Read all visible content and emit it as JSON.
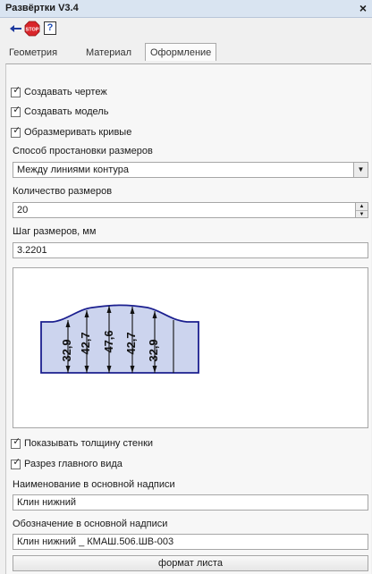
{
  "window": {
    "title": "Развёртки V3.4",
    "close_glyph": "×"
  },
  "toolbar": {
    "icons": [
      "back-arrow-icon",
      "stop-icon",
      "help-icon"
    ],
    "stop_text": "STOP",
    "help_glyph": "?"
  },
  "tabs": [
    {
      "label": "Геометрия",
      "active": false
    },
    {
      "label": "Материал",
      "active": false
    },
    {
      "label": "Оформление",
      "active": true
    }
  ],
  "options": {
    "create_drawing": {
      "label": "Создавать чертеж",
      "checked": true
    },
    "create_model": {
      "label": "Создавать модель",
      "checked": true
    },
    "dimension_curves": {
      "label": "Образмеривать кривые",
      "checked": true
    }
  },
  "dimension_method": {
    "label": "Способ простановки размеров",
    "value": "Между линиями контура"
  },
  "dimension_count": {
    "label": "Количество размеров",
    "value": "20"
  },
  "dimension_step": {
    "label": "Шаг размеров, мм",
    "value": "3.2201"
  },
  "preview": {
    "dimensions": [
      "32,9",
      "42,7",
      "47,6",
      "42,7",
      "32,9"
    ]
  },
  "show_wall_thickness": {
    "label": "Показывать толщину стенки",
    "checked": true
  },
  "main_view_section": {
    "label": "Разрез главного вида",
    "checked": true
  },
  "title_name": {
    "label": "Наименование в основной надписи",
    "value": "Клин нижний"
  },
  "title_designation": {
    "label": "Обозначение в основной надписи",
    "value": "Клин нижний _ КМАШ.506.ШВ-003"
  },
  "sheet_format_button": "формат листа",
  "colors": {
    "shape_fill": "#ccd4ee",
    "shape_stroke": "#1b1f8f",
    "stop_red": "#d9262b",
    "help_blue": "#1e4db4"
  }
}
